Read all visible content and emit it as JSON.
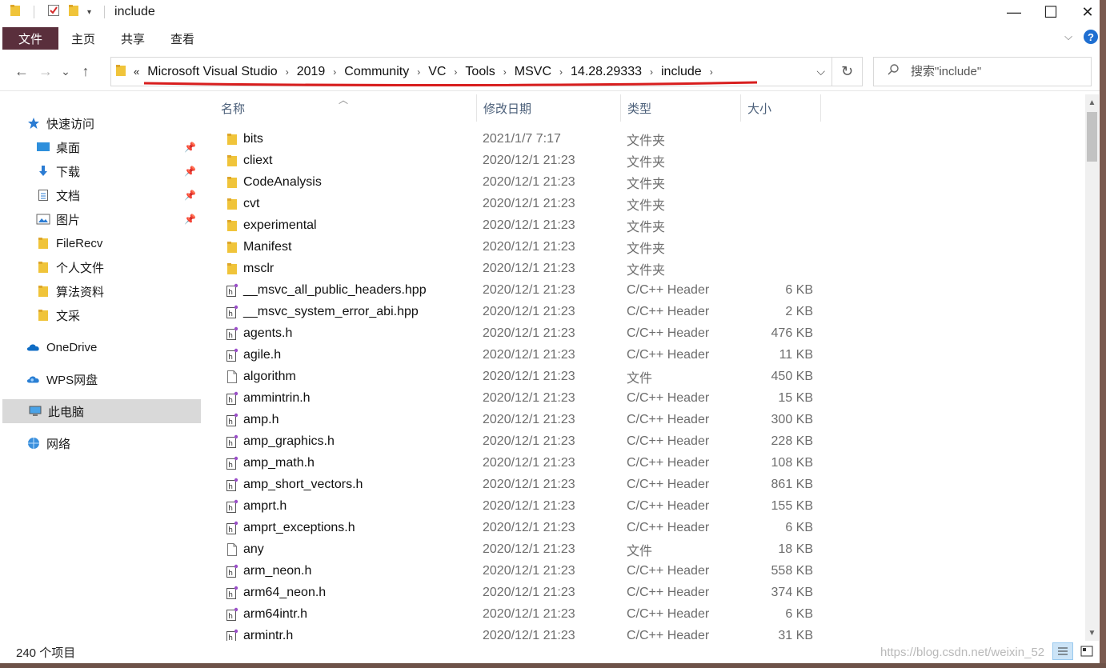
{
  "window": {
    "title": "include",
    "controls": {
      "minimize": "—",
      "maximize": "☐",
      "close": "✕"
    }
  },
  "ribbon": {
    "tabs": [
      "文件",
      "主页",
      "共享",
      "查看"
    ],
    "help": "?"
  },
  "address": {
    "overflow": "«",
    "crumbs": [
      "Microsoft Visual Studio",
      "2019",
      "Community",
      "VC",
      "Tools",
      "MSVC",
      "14.28.29333",
      "include"
    ],
    "separator": "›",
    "dropdown": "⌵",
    "refresh": "↻"
  },
  "nav": {
    "back": "←",
    "forward": "→",
    "recent": "⌄",
    "up": "↑"
  },
  "search": {
    "placeholder": "搜索\"include\""
  },
  "sidebar": {
    "items": [
      {
        "label": "快速访问",
        "icon": "star-icon",
        "pinned": false
      },
      {
        "label": "桌面",
        "icon": "desktop-icon",
        "pinned": true
      },
      {
        "label": "下载",
        "icon": "download-icon",
        "pinned": true
      },
      {
        "label": "文档",
        "icon": "document-icon",
        "pinned": true
      },
      {
        "label": "图片",
        "icon": "picture-icon",
        "pinned": true
      },
      {
        "label": "FileRecv",
        "icon": "folder-icon",
        "pinned": false
      },
      {
        "label": "个人文件",
        "icon": "folder-icon",
        "pinned": false
      },
      {
        "label": "算法资料",
        "icon": "folder-icon",
        "pinned": false
      },
      {
        "label": "文采",
        "icon": "folder-icon",
        "pinned": false
      },
      {
        "label": "OneDrive",
        "icon": "cloud-icon",
        "pinned": false
      },
      {
        "label": "WPS网盘",
        "icon": "cloud-icon",
        "pinned": false
      },
      {
        "label": "此电脑",
        "icon": "computer-icon",
        "pinned": false
      },
      {
        "label": "网络",
        "icon": "network-icon",
        "pinned": false
      }
    ]
  },
  "columns": {
    "name": "名称",
    "date": "修改日期",
    "type": "类型",
    "size": "大小"
  },
  "files": [
    {
      "name": "bits",
      "date": "2021/1/7 7:17",
      "type": "文件夹",
      "size": "",
      "kind": "folder"
    },
    {
      "name": "cliext",
      "date": "2020/12/1 21:23",
      "type": "文件夹",
      "size": "",
      "kind": "folder"
    },
    {
      "name": "CodeAnalysis",
      "date": "2020/12/1 21:23",
      "type": "文件夹",
      "size": "",
      "kind": "folder"
    },
    {
      "name": "cvt",
      "date": "2020/12/1 21:23",
      "type": "文件夹",
      "size": "",
      "kind": "folder"
    },
    {
      "name": "experimental",
      "date": "2020/12/1 21:23",
      "type": "文件夹",
      "size": "",
      "kind": "folder"
    },
    {
      "name": "Manifest",
      "date": "2020/12/1 21:23",
      "type": "文件夹",
      "size": "",
      "kind": "folder"
    },
    {
      "name": "msclr",
      "date": "2020/12/1 21:23",
      "type": "文件夹",
      "size": "",
      "kind": "folder"
    },
    {
      "name": "__msvc_all_public_headers.hpp",
      "date": "2020/12/1 21:23",
      "type": "C/C++ Header",
      "size": "6 KB",
      "kind": "header"
    },
    {
      "name": "__msvc_system_error_abi.hpp",
      "date": "2020/12/1 21:23",
      "type": "C/C++ Header",
      "size": "2 KB",
      "kind": "header"
    },
    {
      "name": "agents.h",
      "date": "2020/12/1 21:23",
      "type": "C/C++ Header",
      "size": "476 KB",
      "kind": "header"
    },
    {
      "name": "agile.h",
      "date": "2020/12/1 21:23",
      "type": "C/C++ Header",
      "size": "11 KB",
      "kind": "header"
    },
    {
      "name": "algorithm",
      "date": "2020/12/1 21:23",
      "type": "文件",
      "size": "450 KB",
      "kind": "file"
    },
    {
      "name": "ammintrin.h",
      "date": "2020/12/1 21:23",
      "type": "C/C++ Header",
      "size": "15 KB",
      "kind": "header"
    },
    {
      "name": "amp.h",
      "date": "2020/12/1 21:23",
      "type": "C/C++ Header",
      "size": "300 KB",
      "kind": "header"
    },
    {
      "name": "amp_graphics.h",
      "date": "2020/12/1 21:23",
      "type": "C/C++ Header",
      "size": "228 KB",
      "kind": "header"
    },
    {
      "name": "amp_math.h",
      "date": "2020/12/1 21:23",
      "type": "C/C++ Header",
      "size": "108 KB",
      "kind": "header"
    },
    {
      "name": "amp_short_vectors.h",
      "date": "2020/12/1 21:23",
      "type": "C/C++ Header",
      "size": "861 KB",
      "kind": "header"
    },
    {
      "name": "amprt.h",
      "date": "2020/12/1 21:23",
      "type": "C/C++ Header",
      "size": "155 KB",
      "kind": "header"
    },
    {
      "name": "amprt_exceptions.h",
      "date": "2020/12/1 21:23",
      "type": "C/C++ Header",
      "size": "6 KB",
      "kind": "header"
    },
    {
      "name": "any",
      "date": "2020/12/1 21:23",
      "type": "文件",
      "size": "18 KB",
      "kind": "file"
    },
    {
      "name": "arm_neon.h",
      "date": "2020/12/1 21:23",
      "type": "C/C++ Header",
      "size": "558 KB",
      "kind": "header"
    },
    {
      "name": "arm64_neon.h",
      "date": "2020/12/1 21:23",
      "type": "C/C++ Header",
      "size": "374 KB",
      "kind": "header"
    },
    {
      "name": "arm64intr.h",
      "date": "2020/12/1 21:23",
      "type": "C/C++ Header",
      "size": "6 KB",
      "kind": "header"
    },
    {
      "name": "armintr.h",
      "date": "2020/12/1 21:23",
      "type": "C/C++ Header",
      "size": "31 KB",
      "kind": "header"
    }
  ],
  "status": {
    "count": "240 个项目",
    "watermark": "https://blog.csdn.net/weixin_52"
  },
  "colors": {
    "file_tab": "#5a2f3c",
    "folder": "#f0c43a",
    "selected": "#d9d9d9",
    "underline": "#d81e1e",
    "accent": "#1f6fd1"
  }
}
